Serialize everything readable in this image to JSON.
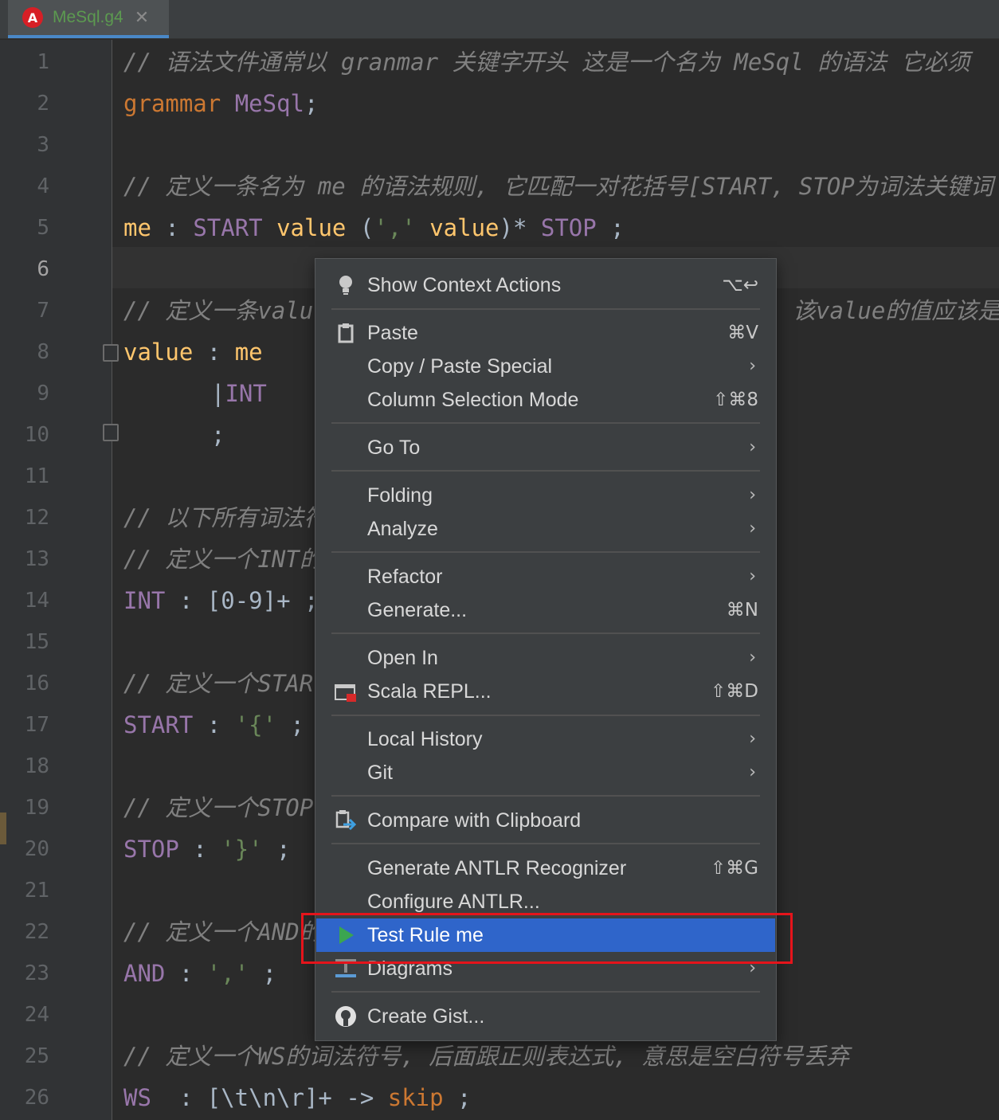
{
  "tab": {
    "icon": "antlr-logo-icon",
    "logo_letter": "A",
    "filename": "MeSql.g4",
    "close": "✕"
  },
  "gutter": {
    "lines": [
      "1",
      "2",
      "3",
      "4",
      "5",
      "6",
      "7",
      "8",
      "9",
      "10",
      "11",
      "12",
      "13",
      "14",
      "15",
      "16",
      "17",
      "18",
      "19",
      "20",
      "21",
      "22",
      "23",
      "24",
      "25",
      "26"
    ],
    "current_line": "6"
  },
  "code": {
    "l1": "// 语法文件通常以 granmar 关键字开头 这是一个名为 MeSql 的语法 它必须",
    "l2_kw": "grammar",
    "l2_name": "MeSql",
    "l2_semi": ";",
    "l4": "// 定义一条名为 me 的语法规则, 它匹配一对花括号[START, STOP为词法关键词",
    "l5_rule": "me",
    "l5_colon": " : ",
    "l5_start": "START",
    "l5_value": "value",
    "l5_open": " (",
    "l5_str": "','",
    "l5_value2": "value",
    "l5_close": ")* ",
    "l5_stop": "STOP",
    "l5_semi": " ;",
    "l7a": "// 定义一条valu",
    "l7b": "该value的值应该是",
    "l8_rule": "value",
    "l8_colon": " : ",
    "l8_me": "me",
    "l9_bar": "|",
    "l9_int": "INT",
    "l10": ";",
    "l12": "// 以下所有词法符",
    "l13": "// 定义一个INT的",
    "l14_tok": "INT",
    "l14_rest": " : [0-9]+ ;",
    "l16": "// 定义一个STAR",
    "l17_tok": "START",
    "l17_colon": " : ",
    "l17_str": "'{'",
    "l17_semi": " ;",
    "l19": "// 定义一个STOP",
    "l20_tok": "STOP",
    "l20_colon": " : ",
    "l20_str": "'}'",
    "l20_semi": " ;",
    "l22": "// 定义一个AND的",
    "l23_tok": "AND",
    "l23_colon": " : ",
    "l23_str": "','",
    "l23_semi": " ;",
    "l25": "// 定义一个WS的词法符号, 后面跟正则表达式, 意思是空白符号丢弃",
    "l26_tok": "WS",
    "l26_rest": "  : [\\t\\n\\r]+ -> ",
    "l26_skip": "skip",
    "l26_semi": " ;"
  },
  "menu": {
    "items": [
      {
        "label": "Show Context Actions",
        "shortcut": "⌥↩",
        "icon": "lightbulb-icon"
      },
      {
        "label": "Paste",
        "shortcut": "⌘V",
        "icon": "clipboard-icon"
      },
      {
        "label": "Copy / Paste Special",
        "arrow": "›"
      },
      {
        "label": "Column Selection Mode",
        "shortcut": "⇧⌘8"
      },
      {
        "label": "Go To",
        "arrow": "›"
      },
      {
        "label": "Folding",
        "arrow": "›"
      },
      {
        "label": "Analyze",
        "arrow": "›"
      },
      {
        "label": "Refactor",
        "arrow": "›"
      },
      {
        "label": "Generate...",
        "shortcut": "⌘N"
      },
      {
        "label": "Open In",
        "arrow": "›"
      },
      {
        "label": "Scala REPL...",
        "shortcut": "⇧⌘D",
        "icon": "scala-repl-icon"
      },
      {
        "label": "Local History",
        "arrow": "›"
      },
      {
        "label": "Git",
        "arrow": "›"
      },
      {
        "label": "Compare with Clipboard",
        "icon": "compare-clipboard-icon"
      },
      {
        "label": "Generate ANTLR Recognizer",
        "shortcut": "⇧⌘G"
      },
      {
        "label": "Configure ANTLR..."
      },
      {
        "label": "Test Rule me",
        "icon": "run-icon",
        "selected": true
      },
      {
        "label": "Diagrams",
        "arrow": "›",
        "icon": "diagram-icon"
      },
      {
        "label": "Create Gist...",
        "icon": "github-icon"
      }
    ]
  },
  "colors": {
    "selection": "#2f65ca",
    "highlight_box": "#e5141b"
  }
}
